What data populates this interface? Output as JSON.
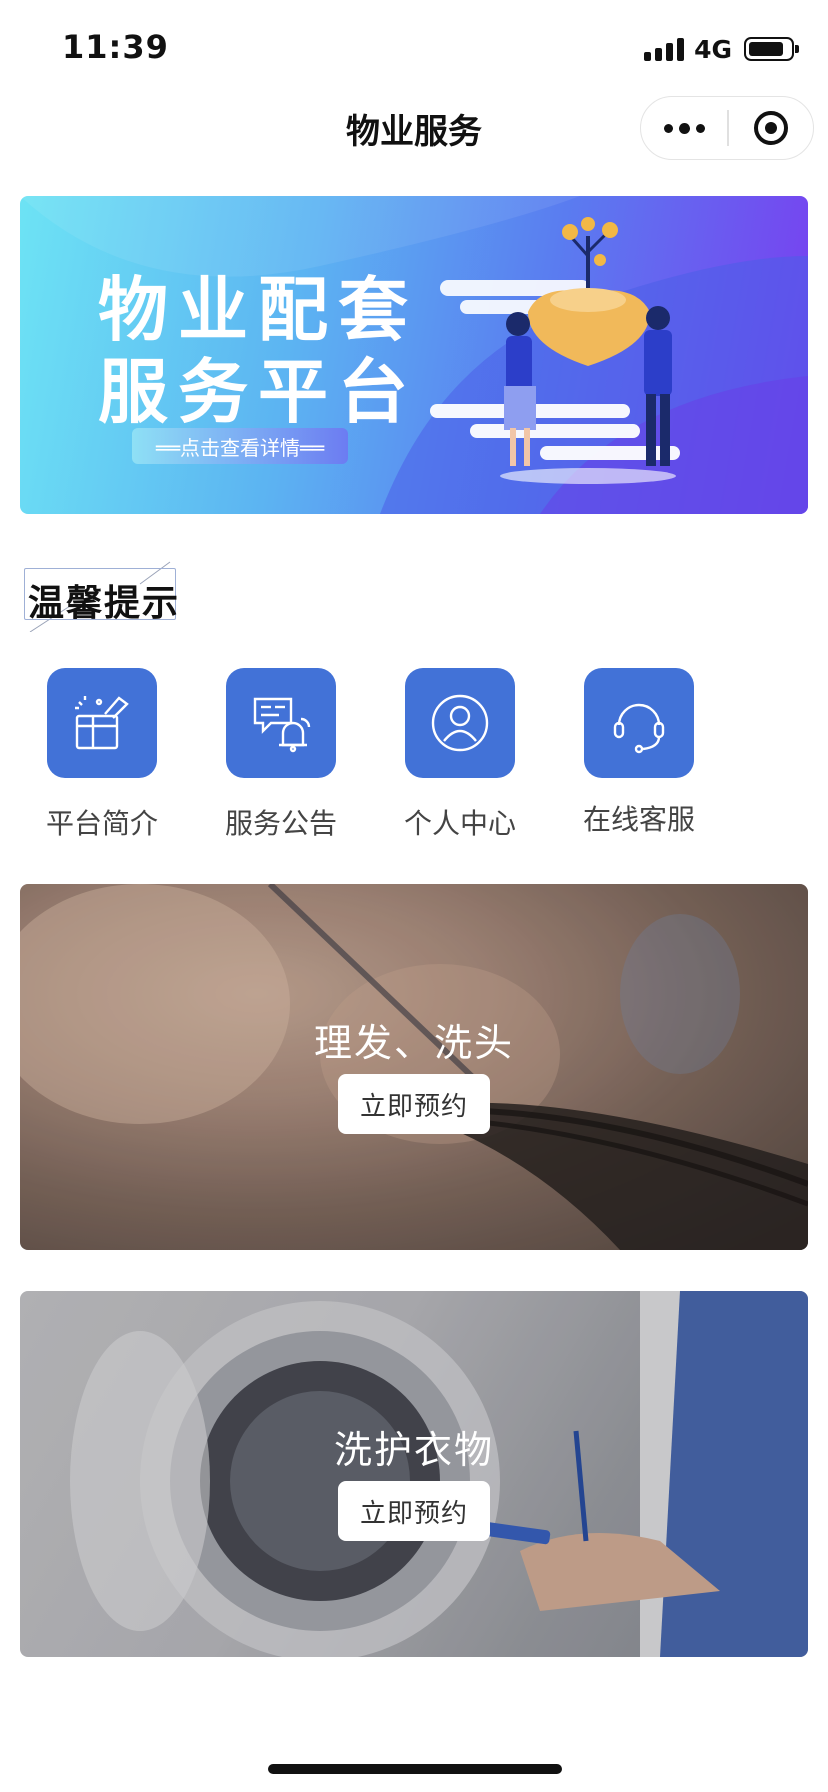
{
  "status_bar": {
    "time": "11:39",
    "network": "4G"
  },
  "nav": {
    "title": "物业服务"
  },
  "banner": {
    "line1": "物业配套",
    "line2": "服务平台",
    "button": "══点击查看详情══"
  },
  "tips": {
    "text": "温馨提示"
  },
  "menu": [
    {
      "label": "平台简介",
      "icon": "gift-box-icon"
    },
    {
      "label": "服务公告",
      "icon": "notice-bell-icon"
    },
    {
      "label": "个人中心",
      "icon": "user-icon"
    },
    {
      "label": "在线客服",
      "icon": "headset-icon"
    }
  ],
  "services": [
    {
      "title": "理发、洗头",
      "button": "立即预约"
    },
    {
      "title": "洗护衣物",
      "button": "立即预约"
    }
  ],
  "colors": {
    "menu_icon_bg": "#4272d7",
    "banner_start": "#6de3f4",
    "banner_end": "#7a3cf0"
  }
}
